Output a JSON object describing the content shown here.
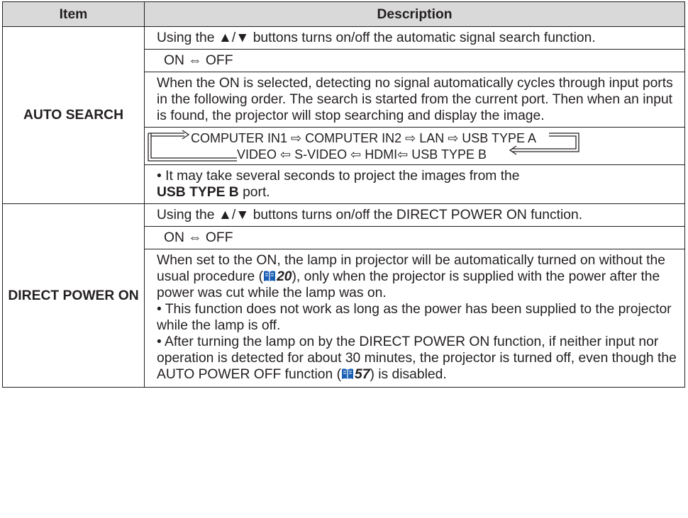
{
  "table": {
    "headers": {
      "item": "Item",
      "description": "Description"
    },
    "rows": [
      {
        "item": "AUTO SEARCH",
        "p1": "Using the ▲/▼ buttons turns on/off the automatic signal search function.",
        "toggle": "ON ⇔ OFF",
        "p2": "When the ON is selected, detecting no signal automatically cycles through input ports in the following order. The search is started from the current port. Then when an input is found, the projector will stop searching and display the image.",
        "cycle_top": "COMPUTER IN1 ⇨ COMPUTER IN2 ⇨ LAN ⇨ USB TYPE A",
        "cycle_bottom": "VIDEO ⇦ S-VIDEO ⇦ HDMI⇦ USB TYPE B",
        "note_prefix": "• It may take several seconds to project the images from the",
        "note_bold": "USB TYPE B",
        "note_suffix": " port."
      },
      {
        "item": "DIRECT POWER ON",
        "p1": "Using the ▲/▼ buttons turns on/off the DIRECT POWER ON function.",
        "toggle": "ON ⇔ OFF",
        "p2_prefix": "When set to the ON, the lamp in projector will be automatically turned on without the usual procedure (",
        "p2_ref": "20",
        "p2_suffix": "), only when the projector is supplied with the power after the power was cut while the lamp was on.",
        "note1": "• This function does not work as long as the power has been supplied to the projector while the lamp is off.",
        "note2_prefix": "• After turning the lamp on by the DIRECT POWER ON function, if neither input nor operation is detected for about 30 minutes, the projector is turned off, even though the AUTO POWER OFF function (",
        "note2_ref": "57",
        "note2_suffix": ") is disabled."
      }
    ]
  },
  "icons": {
    "reference": "book-icon",
    "reference_color": "#1a5fb4"
  }
}
